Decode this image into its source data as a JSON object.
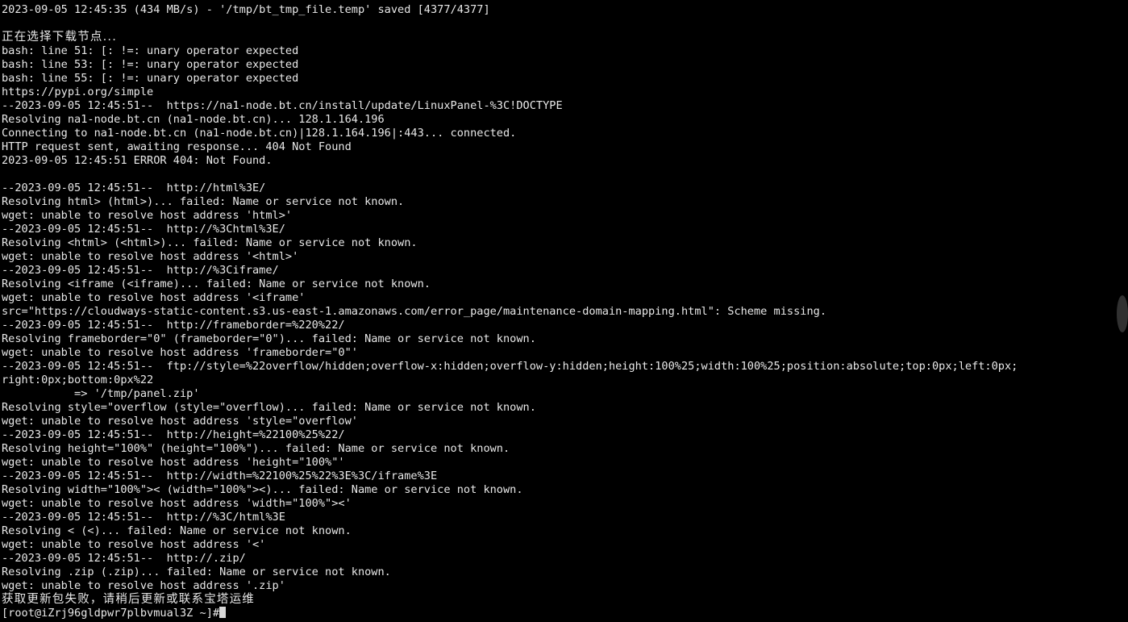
{
  "terminal": {
    "background_color": "#000000",
    "foreground_color": "#e8e8e8",
    "prompt": "[root@iZrj96gldpwr7plbvmual3Z ~]#",
    "hostname": "iZrj96gldpwr7plbvmual3Z",
    "user": "root",
    "cwd": "~",
    "scroll_indicator_color": "#3a3a3a",
    "lines": [
      "2023-09-05 12:45:35 (434 MB/s) - '/tmp/bt_tmp_file.temp' saved [4377/4377]",
      "",
      "正在选择下载节点...",
      "bash: line 51: [: !=: unary operator expected",
      "bash: line 53: [: !=: unary operator expected",
      "bash: line 55: [: !=: unary operator expected",
      "https://pypi.org/simple",
      "--2023-09-05 12:45:51--  https://na1-node.bt.cn/install/update/LinuxPanel-%3C!DOCTYPE",
      "Resolving na1-node.bt.cn (na1-node.bt.cn)... 128.1.164.196",
      "Connecting to na1-node.bt.cn (na1-node.bt.cn)|128.1.164.196|:443... connected.",
      "HTTP request sent, awaiting response... 404 Not Found",
      "2023-09-05 12:45:51 ERROR 404: Not Found.",
      "",
      "--2023-09-05 12:45:51--  http://html%3E/",
      "Resolving html> (html>)... failed: Name or service not known.",
      "wget: unable to resolve host address 'html>'",
      "--2023-09-05 12:45:51--  http://%3Chtml%3E/",
      "Resolving <html> (<html>)... failed: Name or service not known.",
      "wget: unable to resolve host address '<html>'",
      "--2023-09-05 12:45:51--  http://%3Ciframe/",
      "Resolving <iframe (<iframe)... failed: Name or service not known.",
      "wget: unable to resolve host address '<iframe'",
      "src=\"https://cloudways-static-content.s3.us-east-1.amazonaws.com/error_page/maintenance-domain-mapping.html\": Scheme missing.",
      "--2023-09-05 12:45:51--  http://frameborder=%220%22/",
      "Resolving frameborder=\"0\" (frameborder=\"0\")... failed: Name or service not known.",
      "wget: unable to resolve host address 'frameborder=\"0\"'",
      "--2023-09-05 12:45:51--  ftp://style=%22overflow/hidden;overflow-x:hidden;overflow-y:hidden;height:100%25;width:100%25;position:absolute;top:0px;left:0px;",
      "right:0px;bottom:0px%22",
      "           => '/tmp/panel.zip'",
      "Resolving style=\"overflow (style=\"overflow)... failed: Name or service not known.",
      "wget: unable to resolve host address 'style=\"overflow'",
      "--2023-09-05 12:45:51--  http://height=%22100%25%22/",
      "Resolving height=\"100%\" (height=\"100%\")... failed: Name or service not known.",
      "wget: unable to resolve host address 'height=\"100%\"'",
      "--2023-09-05 12:45:51--  http://width=%22100%25%22%3E%3C/iframe%3E",
      "Resolving width=\"100%\">< (width=\"100%\"><)... failed: Name or service not known.",
      "wget: unable to resolve host address 'width=\"100%\"><'",
      "--2023-09-05 12:45:51--  http://%3C/html%3E",
      "Resolving < (<)... failed: Name or service not known.",
      "wget: unable to resolve host address '<'",
      "--2023-09-05 12:45:51--  http://.zip/",
      "Resolving .zip (.zip)... failed: Name or service not known.",
      "wget: unable to resolve host address '.zip'",
      "获取更新包失败，请稍后更新或联系宝塔运维"
    ],
    "cjk_line_indices": [
      2,
      43
    ]
  }
}
